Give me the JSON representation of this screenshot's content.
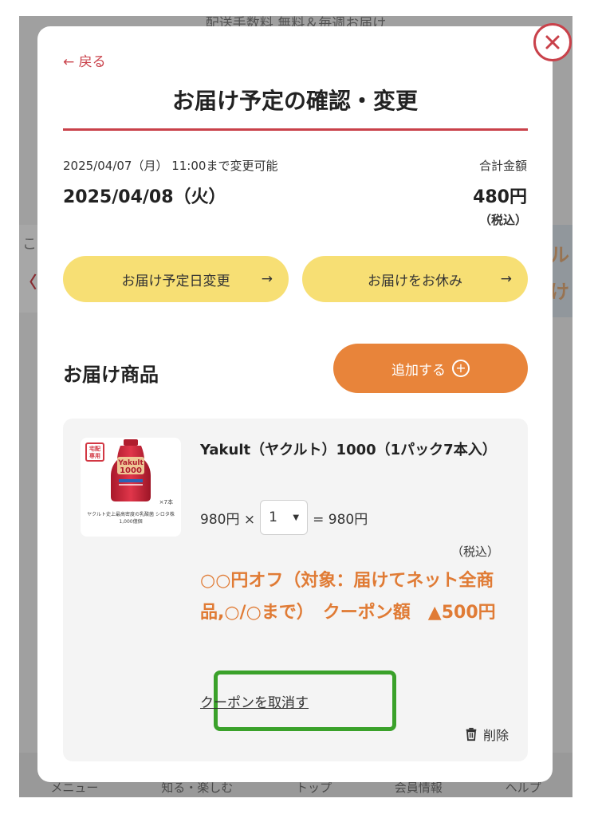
{
  "background": {
    "top_text": "配送手数料 無料＆毎週お届け",
    "left_char": "こ",
    "right_char_1": "ル",
    "right_char_2": "け",
    "nav": [
      "メニュー",
      "知る・楽しむ",
      "トップ",
      "会員情報",
      "ヘルプ"
    ]
  },
  "modal": {
    "back_label": "← 戻る",
    "title": "お届け予定の確認・変更",
    "change_deadline": "2025/04/07（月） 11:00まで変更可能",
    "delivery_date": "2025/04/08（火）",
    "total_label": "合計金額",
    "total_amount": "480円",
    "total_tax": "（税込）",
    "btn_change_date": "お届け予定日変更",
    "btn_skip": "お届けをお休み",
    "arrow": "→",
    "section_title": "お届け商品",
    "add_label": "追加する",
    "add_icon": "⊕"
  },
  "product": {
    "badge": "宅配専用",
    "image_count": "×7本",
    "image_caption": "ヤクルト史上最高密度の乳酸菌 シロタ株 1,000億個",
    "name": "Yakult（ヤクルト）1000（1パック7本入）",
    "unit_price": "980円 ×",
    "quantity": "1",
    "line_total": "= 980円",
    "tax_label": "（税込）",
    "coupon_text": "○○円オフ（対象：届けてネット全商品,○/○まで）　クーポン額　▲500円",
    "coupon_cancel": "クーポンを取消す",
    "delete_label": "削除"
  },
  "colors": {
    "accent_red": "#c9414a",
    "yellow_button": "#f7df74",
    "orange_button": "#e8843a",
    "coupon_orange": "#e07b35",
    "highlight_green": "#3aa12a"
  }
}
